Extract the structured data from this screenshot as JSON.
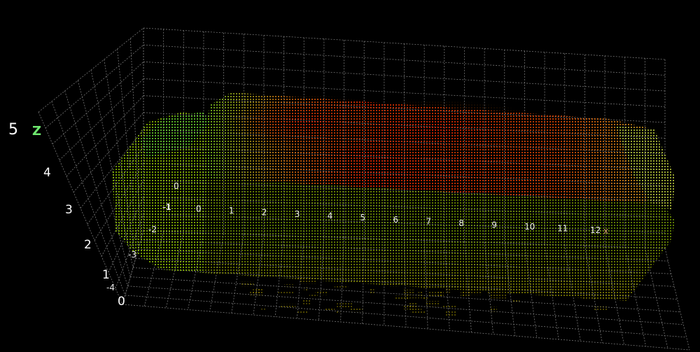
{
  "chart_data": {
    "type": "scatter",
    "title": "",
    "z_axis": {
      "label": "Z",
      "ticks": [
        "5",
        "4",
        "3",
        "2",
        "1",
        "0"
      ]
    },
    "x_axis": {
      "label": "X",
      "ticks": [
        "-1",
        "0",
        "1",
        "2",
        "3",
        "4",
        "5",
        "6",
        "7",
        "8",
        "9",
        "10",
        "11",
        "12"
      ]
    },
    "y_axis": {
      "label": "",
      "ticks": [
        "0",
        "-1",
        "-2",
        "-3",
        "-4"
      ]
    },
    "xlim": [
      -1,
      12
    ],
    "ylim": [
      -4,
      0
    ],
    "zlim": [
      0,
      5
    ],
    "grid": true,
    "colormap": {
      "low": "#c8c800",
      "mid": "#70e020",
      "high": "#ff1800"
    },
    "series": [
      {
        "values": "truck-shaped point cloud; height encoded by color (yellow low, green mid, red high)"
      }
    ]
  }
}
